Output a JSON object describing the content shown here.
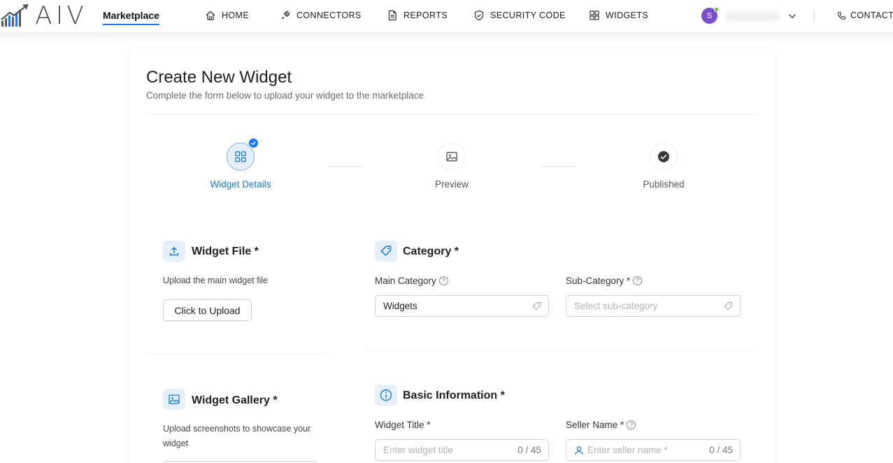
{
  "header": {
    "brand": "Marketplace",
    "logo_text": "AIV",
    "nav": [
      {
        "label": "HOME",
        "icon": "home-icon"
      },
      {
        "label": "CONNECTORS",
        "icon": "plug-icon"
      },
      {
        "label": "REPORTS",
        "icon": "file-icon"
      },
      {
        "label": "SECURITY CODE",
        "icon": "shield-icon"
      },
      {
        "label": "WIDGETS",
        "icon": "grid-icon"
      }
    ],
    "user_initial": "S",
    "contact": "CONTACT"
  },
  "page": {
    "title": "Create New Widget",
    "subtitle": "Complete the form below to upload your widget to the marketplace"
  },
  "steps": [
    {
      "label": "Widget Details",
      "state": "active"
    },
    {
      "label": "Preview",
      "state": "pending"
    },
    {
      "label": "Published",
      "state": "pending"
    }
  ],
  "widget_file": {
    "title": "Widget File *",
    "description": "Upload the main widget file",
    "button": "Click to Upload"
  },
  "category": {
    "title": "Category *",
    "main_label": "Main Category",
    "main_value": "Widgets",
    "sub_label": "Sub-Category *",
    "sub_placeholder": "Select sub-category"
  },
  "widget_gallery": {
    "title": "Widget Gallery *",
    "description_line1": "Upload screenshots to showcase your",
    "description_line2": "widget"
  },
  "basic_info": {
    "title": "Basic Information *",
    "widget_title_label": "Widget Title *",
    "widget_title_placeholder": "Enter widget title",
    "widget_title_count": "0 / 45",
    "seller_label": "Seller Name *",
    "seller_placeholder": "Enter seller name *",
    "seller_count": "0 / 45"
  },
  "colors": {
    "accent": "#1677ff",
    "step_active": "#1677cc",
    "avatar": "#7b4fc9",
    "online": "#52c41a"
  }
}
